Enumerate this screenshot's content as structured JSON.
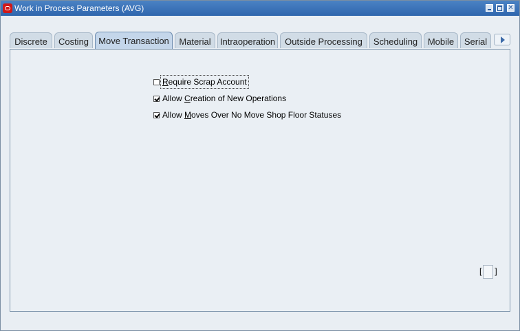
{
  "window": {
    "title": "Work in Process Parameters (AVG)"
  },
  "tabs": [
    {
      "label": "Discrete",
      "active": false
    },
    {
      "label": "Costing",
      "active": false
    },
    {
      "label": "Move Transaction",
      "active": true
    },
    {
      "label": "Material",
      "active": false
    },
    {
      "label": "Intraoperation",
      "active": false
    },
    {
      "label": "Outside Processing",
      "active": false
    },
    {
      "label": "Scheduling",
      "active": false
    },
    {
      "label": "Mobile",
      "active": false
    },
    {
      "label": "Serial",
      "active": false
    }
  ],
  "checkboxes": [
    {
      "label_pre": "",
      "label_key": "R",
      "label_post": "equire Scrap Account",
      "checked": false
    },
    {
      "label_pre": "Allow ",
      "label_key": "C",
      "label_post": "reation of New Operations",
      "checked": true
    },
    {
      "label_pre": "Allow ",
      "label_key": "M",
      "label_post": "oves Over No Move Shop Floor Statuses",
      "checked": true
    }
  ],
  "bracket": {
    "left": "[",
    "right": "]"
  },
  "colors": {
    "titlebar": "#3a72b8",
    "panel": "#eaeff4",
    "active_tab": "#c4d6ea"
  }
}
